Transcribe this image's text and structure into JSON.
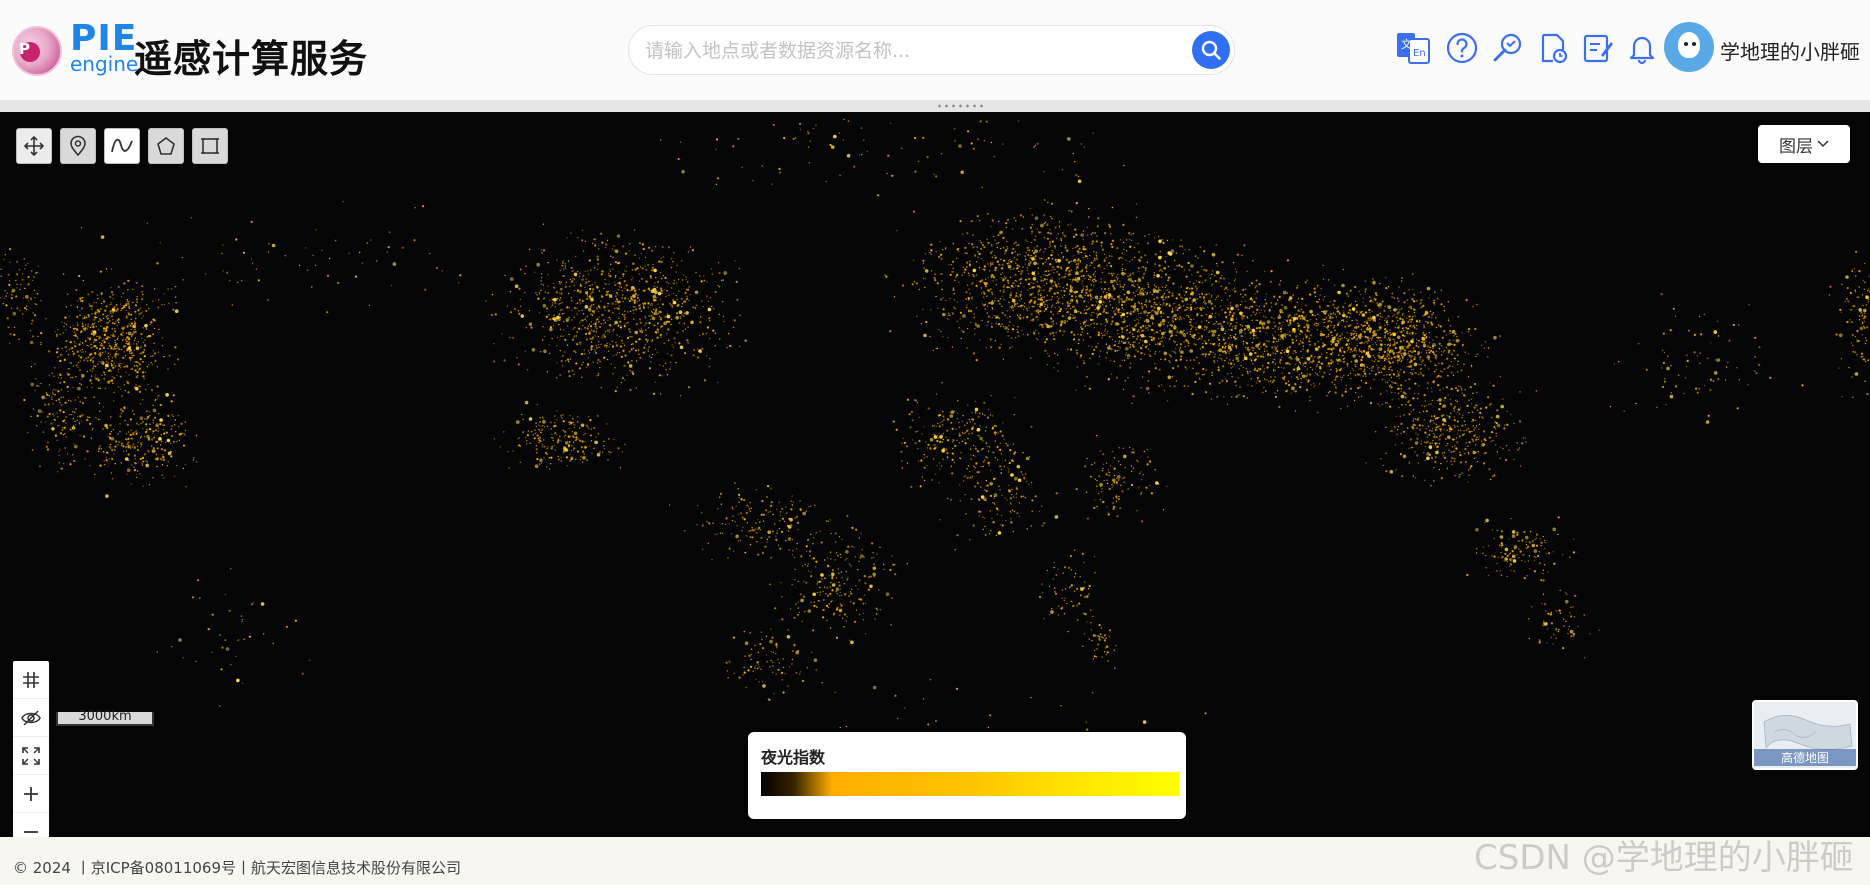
{
  "header": {
    "logo_pie": "PIE",
    "logo_engine": "engine",
    "logo_badge": "P",
    "title": "遥感计算服务",
    "search_placeholder": "请输入地点或者数据资源名称...",
    "icons": [
      "translate-icon",
      "help-icon",
      "tools-icon",
      "document-clock-icon",
      "edit-note-icon",
      "bell-icon"
    ],
    "username": "学地理的小胖砸"
  },
  "map": {
    "draw_tools": [
      "pan-tool-icon",
      "marker-tool-icon",
      "curve-tool-icon",
      "polygon-tool-icon",
      "rectangle-tool-icon"
    ],
    "layer_button": "图层",
    "controls": [
      "graticule-icon",
      "hide-icon",
      "fullscreen-icon",
      "zoom-in-icon",
      "zoom-out-icon"
    ],
    "scale_label": "3000km",
    "legend": {
      "title": "夜光指数",
      "colors": [
        "#000000",
        "#ffae00",
        "#ffc400",
        "#ffff00"
      ]
    },
    "minimap_label": "高德地图",
    "colors": {
      "background": "#050505",
      "lights": "#ffb000",
      "bright_lights": "#ffd94a"
    }
  },
  "footer": {
    "copyright": "© 2024 丨京ICP备08011069号丨航天宏图信息技术股份有限公司"
  },
  "watermark": "CSDN @学地理的小胖砸"
}
